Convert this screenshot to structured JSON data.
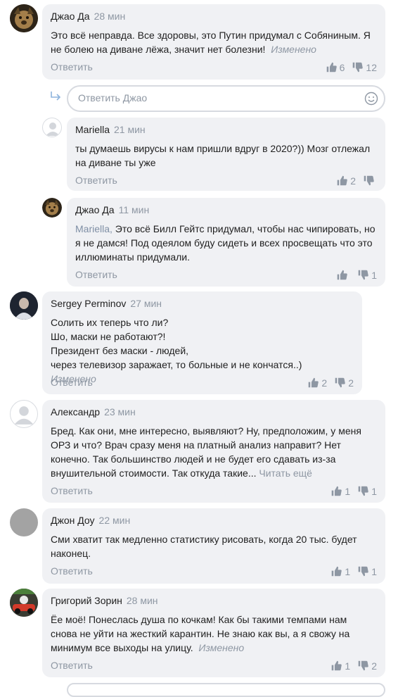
{
  "labels": {
    "reply": "Ответить",
    "edited": "Изменено",
    "read_more": "Читать ещё"
  },
  "reply_input": {
    "placeholder": "Ответить Джао"
  },
  "comments": [
    {
      "author": "Джао Да",
      "time": "28 мин",
      "lines": [
        "Это всё неправда. Все здоровы, это Путин придумал с Собяниным. Я не болею на диване лёжа, значит нет болезни!"
      ],
      "likes": "6",
      "dislikes": "12",
      "avatar": "dog-avatar"
    },
    {
      "author": "Mariella",
      "time": "21 мин",
      "lines": [
        "ты думаешь вирусы к нам пришли вдруг в 2020?)) Мозг отлежал на диване ты уже"
      ],
      "likes": "2",
      "dislikes": "",
      "avatar": "default-user-icon"
    },
    {
      "author": "Джао Да",
      "time": "11 мин",
      "mention": "Mariella,",
      "lines": [
        "Это всё Билл Гейтс придумал, чтобы нас чипировать, но я не дамся! Под одеялом буду сидеть и всех просвещать что это иллюминаты придумали."
      ],
      "likes": "",
      "dislikes": "1",
      "avatar": "dog-avatar"
    },
    {
      "author": "Sergey Perminov",
      "time": "27 мин",
      "lines": [
        "Солить их теперь что ли?",
        "Шо, маски не работают?!",
        "Президент без маски - людей,",
        "через телевизор заражает, то больные и не кончатся..)"
      ],
      "likes": "2",
      "dislikes": "2",
      "avatar": "man-photo-avatar"
    },
    {
      "author": "Александр",
      "time": "23 мин",
      "lines": [
        "Бред. Как они, мне  интересно, выявляют? Ну, предположим, у меня ОРЗ и что? Врач сразу меня на платный анализ направит? Нет конечно. Так большинство людей и не будет его сдавать из-за внушительной стоимости. Так откуда такие..."
      ],
      "likes": "1",
      "dislikes": "1",
      "avatar": "default-user-icon"
    },
    {
      "author": "Джон Доу",
      "time": "22 мин",
      "lines": [
        "Сми хватит так медленно статистику рисовать, когда 20 тыс. будет наконец."
      ],
      "likes": "1",
      "dislikes": "1",
      "avatar": "grey-avatar"
    },
    {
      "author": "Григорий Зорин",
      "time": "28 мин",
      "lines": [
        "Ёе моё! Понеслась душа по кочкам! Как бы такими  темпами нам снова не уйти на жесткий карантин. Не знаю как вы, а я свожу на минимум все выходы на улицу."
      ],
      "likes": "1",
      "dislikes": "2",
      "avatar": "kart-photo-avatar"
    }
  ],
  "colors": {
    "card_bg": "#f0f1f4",
    "meta_text": "#8e97a3",
    "text": "#1f1f1f"
  }
}
